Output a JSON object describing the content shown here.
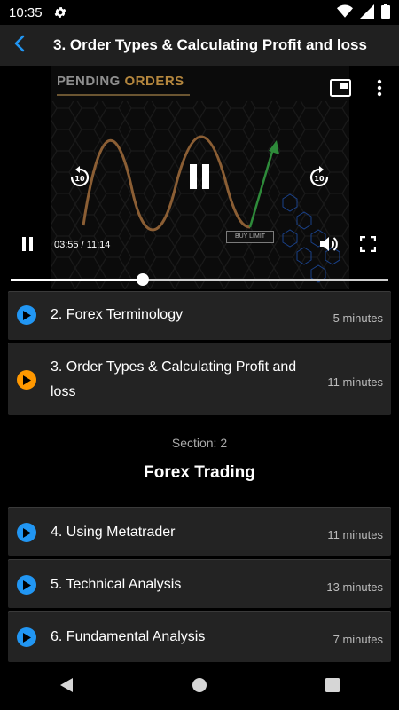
{
  "status_bar": {
    "time": "10:35",
    "icons": [
      "settings-gear-icon",
      "wifi-icon",
      "cell-signal-icon",
      "battery-icon"
    ]
  },
  "app_bar": {
    "title": "3. Order Types & Calculating Profit and loss",
    "back_icon": "back-arrow-icon",
    "accent": "#2196f3"
  },
  "player": {
    "slide_title_part1": "PENDING",
    "slide_title_part2": "ORDERS",
    "slide_label": "BUY LIMIT",
    "current_time": "03:55",
    "separator": " / ",
    "total_time": "11:14",
    "progress_fraction": 0.349,
    "icons": [
      "pip-icon",
      "more-vert-icon",
      "replay-10-icon",
      "pause-icon",
      "forward-10-icon",
      "volume-icon",
      "fullscreen-icon"
    ]
  },
  "lessons_top": [
    {
      "title": "2. Forex Terminology",
      "duration": "5 minutes",
      "state": "not-started"
    },
    {
      "title": "3. Order Types & Calculating Profit and",
      "title_line2": "loss",
      "duration": "11 minutes",
      "state": "current"
    }
  ],
  "section": {
    "label": "Section: 2",
    "title": "Forex Trading"
  },
  "lessons_bottom": [
    {
      "title": "4. Using Metatrader",
      "duration": "11 minutes"
    },
    {
      "title": "5. Technical Analysis",
      "duration": "13 minutes"
    },
    {
      "title": "6. Fundamental Analysis",
      "duration": "7 minutes"
    }
  ],
  "colors": {
    "play_blue": "#2196f3",
    "play_orange": "#ff9800",
    "card_bg": "#232323"
  },
  "nav_bar": {
    "icons": [
      "nav-back-icon",
      "nav-home-icon",
      "nav-recents-icon"
    ]
  }
}
